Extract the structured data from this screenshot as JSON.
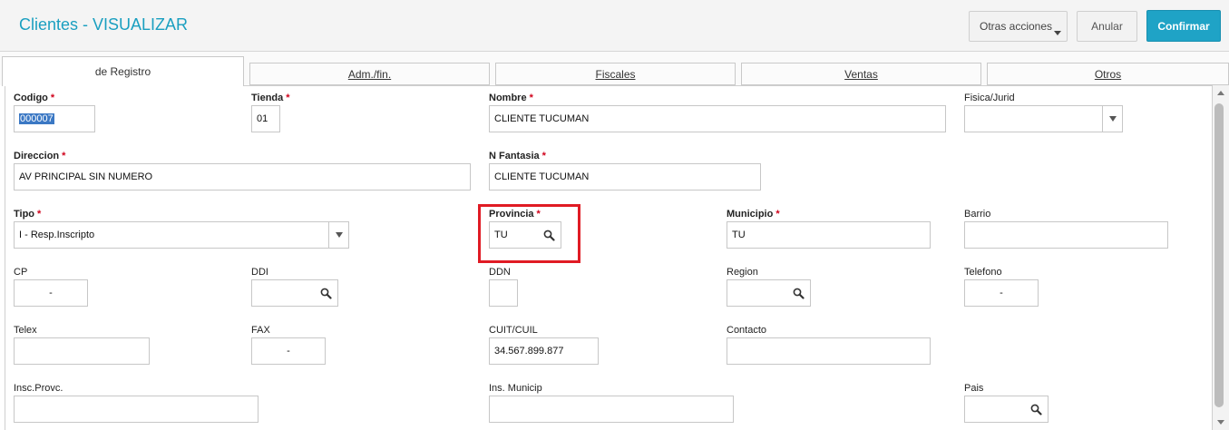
{
  "header": {
    "title": "Clientes - VISUALIZAR",
    "other_actions_label": "Otras acciones",
    "cancel_label": "Anular",
    "confirm_label": "Confirmar"
  },
  "tabs": [
    {
      "label": "de Registro",
      "active": true
    },
    {
      "label": "Adm./fin."
    },
    {
      "label": "Fiscales"
    },
    {
      "label": "Ventas"
    },
    {
      "label": "Otros"
    }
  ],
  "fields": {
    "codigo": {
      "label": "Codigo",
      "value": "000007",
      "required": true
    },
    "tienda": {
      "label": "Tienda",
      "value": "01",
      "required": true
    },
    "nombre": {
      "label": "Nombre",
      "value": "CLIENTE TUCUMAN",
      "required": true
    },
    "fisica_jurid": {
      "label": "Fisica/Jurid",
      "value": ""
    },
    "direccion": {
      "label": "Direccion",
      "value": "AV PRINCIPAL SIN NUMERO",
      "required": true
    },
    "n_fantasia": {
      "label": "N Fantasia",
      "value": "CLIENTE TUCUMAN",
      "required": true
    },
    "tipo": {
      "label": "Tipo",
      "value": "I - Resp.Inscripto",
      "required": true
    },
    "provincia": {
      "label": "Provincia",
      "value": "TU",
      "required": true
    },
    "municipio": {
      "label": "Municipio",
      "value": "TU",
      "required": true
    },
    "barrio": {
      "label": "Barrio",
      "value": ""
    },
    "cp": {
      "label": "CP",
      "value": "-"
    },
    "ddi": {
      "label": "DDI",
      "value": ""
    },
    "ddn": {
      "label": "DDN",
      "value": ""
    },
    "region": {
      "label": "Region",
      "value": ""
    },
    "telefono": {
      "label": "Telefono",
      "value": "-"
    },
    "telex": {
      "label": "Telex",
      "value": ""
    },
    "fax": {
      "label": "FAX",
      "value": "-"
    },
    "cuit_cuil": {
      "label": "CUIT/CUIL",
      "value": "34.567.899.877"
    },
    "contacto": {
      "label": "Contacto",
      "value": ""
    },
    "insc_provc": {
      "label": "Insc.Provc.",
      "value": ""
    },
    "ins_municip": {
      "label": "Ins. Municip",
      "value": ""
    },
    "pais": {
      "label": "Pais",
      "value": ""
    }
  },
  "colors": {
    "accent": "#1fa3c6",
    "title": "#1a9fc0",
    "required": "#d0021b",
    "highlight": "#e01b24"
  }
}
